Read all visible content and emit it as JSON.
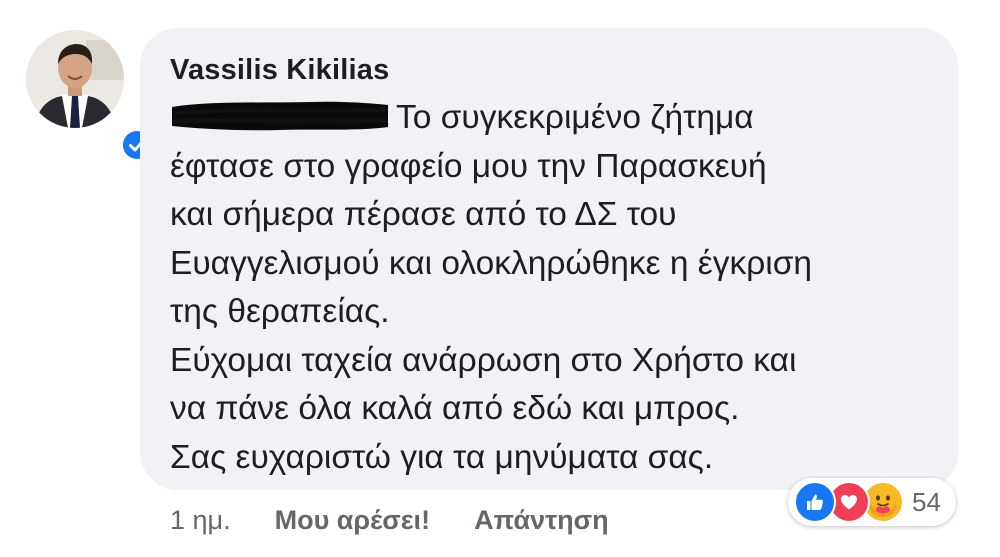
{
  "comment": {
    "author": "Vassilis Kikilias",
    "verified": true,
    "lines": [
      "Το συγκεκριμένο ζήτημα",
      "έφτασε στο γραφείο μου την Παρασκευή",
      "και σήμερα πέρασε από το ΔΣ του",
      "Ευαγγελισμού και ολοκληρώθηκε η έγκριση",
      "της θεραπείας.",
      "Εύχομαι ταχεία ανάρρωση στο Χρήστο και",
      "να πάνε όλα καλά από εδώ και μπρος.",
      "Σας ευχαριστώ για τα μηνύματα σας."
    ]
  },
  "footer": {
    "time": "1 ημ.",
    "like_label": "Μου αρέσει!",
    "reply_label": "Απάντηση"
  },
  "reactions": {
    "icons": [
      "like-icon",
      "love-icon",
      "care-icon"
    ],
    "count": "54",
    "colors": {
      "like": "#1877f2",
      "love": "#f33e58",
      "care": "#f7b928"
    }
  },
  "colors": {
    "bubble": "#f0f2f5",
    "text": "#1c1e21",
    "muted": "#65676b",
    "verified": "#1877f2"
  }
}
